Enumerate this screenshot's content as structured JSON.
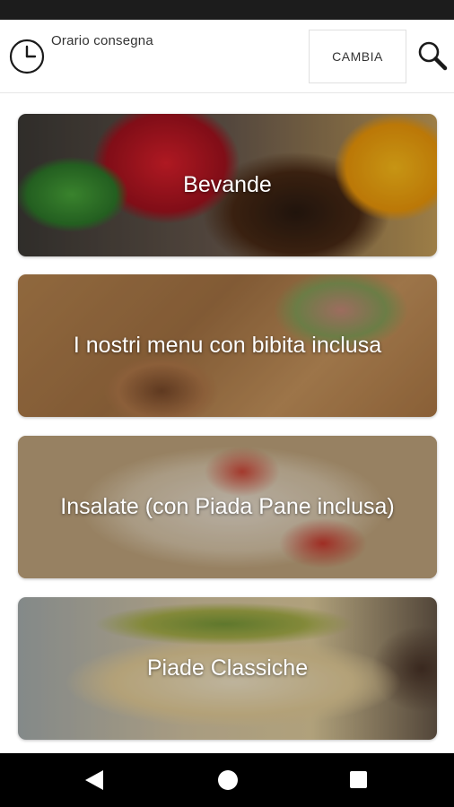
{
  "header": {
    "title": "Orario consegna",
    "change_label": "CAMBIA",
    "clock_icon": "clock-icon",
    "search_icon": "search-icon"
  },
  "categories": [
    {
      "label": "Bevande"
    },
    {
      "label": "I nostri menu con bibita inclusa"
    },
    {
      "label": "Insalate (con Piada Pane inclusa)"
    },
    {
      "label": "Piade Classiche"
    }
  ],
  "nav": {
    "back_icon": "back-triangle-icon",
    "home_icon": "home-circle-icon",
    "recent_icon": "recent-square-icon"
  },
  "colors": {
    "status_bar": "#1c1c1c",
    "nav_bar": "#000000",
    "text": "#333333"
  }
}
